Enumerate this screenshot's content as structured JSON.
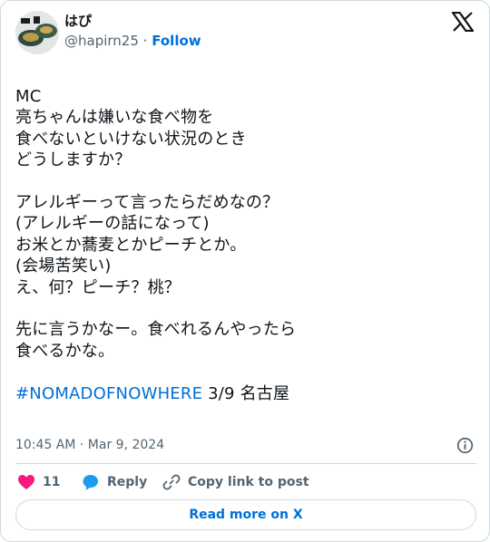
{
  "author": {
    "display_name": "はぴ",
    "handle": "@hapirn25",
    "separator": "·",
    "follow_label": "Follow"
  },
  "tweet": {
    "body": "MC\n亮ちゃんは嫌いな食べ物を\n食べないといけない状況のとき\nどうしますか？\n\nアレルギーって言ったらだめなの？\n(アレルギーの話になって)\nお米とか蕎麦とかピーチとか。\n(会場苦笑い)\nえ、何？ピーチ？桃？\n\n先に言うかなー。食べれるんやったら\n食べるかな。\n\n",
    "hashtag": "#NOMADOFNOWHERE",
    "tail": " 3/9 名古屋"
  },
  "meta": {
    "timestamp": "10:45 AM · Mar 9, 2024"
  },
  "actions": {
    "like_count": "11",
    "reply_label": "Reply",
    "copy_label": "Copy link to post"
  },
  "footer": {
    "read_more_label": "Read more on X"
  },
  "colors": {
    "link": "#006fd6",
    "like": "#f91880",
    "secondary_text": "#536471",
    "border": "#cfd9de"
  }
}
